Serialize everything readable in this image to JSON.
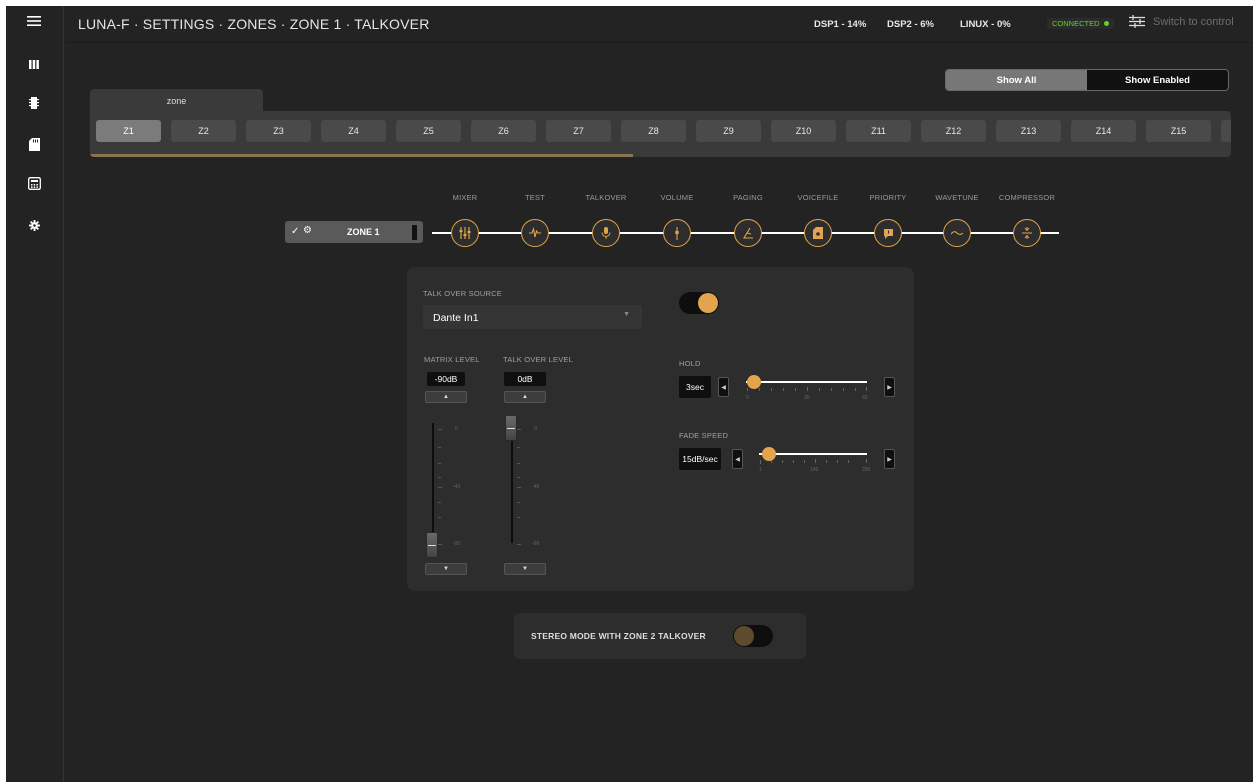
{
  "header": {
    "breadcrumb": "LUNA-F · SETTINGS · ZONES · ZONE 1 · TALKOVER",
    "stats": [
      {
        "label": "DSP1 - 14%"
      },
      {
        "label": "DSP2 - 6%"
      },
      {
        "label": "LINUX - 0%"
      }
    ],
    "connection": "CONNECTED",
    "switch_control": "Switch to control"
  },
  "sidebar": {
    "icons": [
      "menu-icon",
      "bars-icon",
      "chip-icon",
      "sd-card-icon",
      "calculator-icon",
      "gear-icon"
    ]
  },
  "filter": {
    "show_all": "Show All",
    "show_enabled": "Show Enabled",
    "active": "show_all"
  },
  "zones": {
    "tab_label": "zone",
    "items": [
      "Z1",
      "Z2",
      "Z3",
      "Z4",
      "Z5",
      "Z6",
      "Z7",
      "Z8",
      "Z9",
      "Z10",
      "Z11",
      "Z12",
      "Z13",
      "Z14",
      "Z15"
    ],
    "active": "Z1"
  },
  "pipeline": {
    "zone_label": "ZONE 1",
    "stages": [
      {
        "label": "MIXER",
        "icon": "sliders-icon"
      },
      {
        "label": "TEST",
        "icon": "waveform-icon"
      },
      {
        "label": "TALKOVER",
        "icon": "microphone-icon"
      },
      {
        "label": "VOLUME",
        "icon": "volume-fader-icon"
      },
      {
        "label": "PAGING",
        "icon": "paging-icon"
      },
      {
        "label": "VOICEFILE",
        "icon": "file-icon"
      },
      {
        "label": "PRIORITY",
        "icon": "flag-icon"
      },
      {
        "label": "WAVETUNE",
        "icon": "wave-icon"
      },
      {
        "label": "COMPRESSOR",
        "icon": "compressor-icon"
      }
    ],
    "accent": "#e2a44d"
  },
  "talkover": {
    "source_label": "TALK OVER SOURCE",
    "source_value": "Dante In1",
    "enabled": true,
    "matrix_level_label": "MATRIX LEVEL",
    "matrix_level_value": "-90dB",
    "talkover_level_label": "TALK OVER LEVEL",
    "talkover_level_value": "0dB",
    "fader_scale": [
      "0",
      "-40",
      "-90"
    ],
    "hold_label": "HOLD",
    "hold_value": "3sec",
    "hold_scale": [
      "0",
      "30",
      "60"
    ],
    "fade_label": "FADE SPEED",
    "fade_value": "15dB/sec",
    "fade_scale": [
      "1",
      "146",
      "200"
    ]
  },
  "stereo": {
    "label": "STEREO MODE WITH ZONE 2 TALKOVER",
    "enabled": false
  }
}
